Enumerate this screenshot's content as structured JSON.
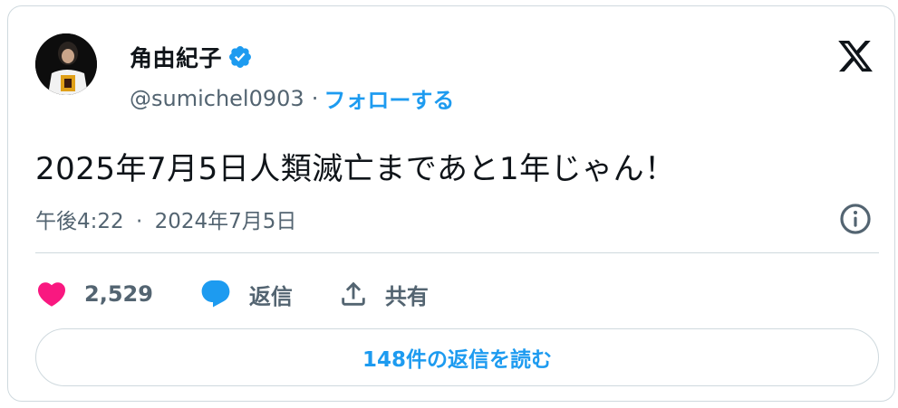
{
  "author": {
    "name": "角由紀子",
    "handle": "@sumichel0903",
    "separator": "·",
    "follow_label": "フォローする"
  },
  "tweet": {
    "text": "2025年7月5日人類滅亡まであと1年じゃん！",
    "time": "午後4:22",
    "date": "2024年7月5日",
    "separator": "·"
  },
  "actions": {
    "likes": "2,529",
    "reply_label": "返信",
    "share_label": "共有"
  },
  "read_replies_label": "148件の返信を読む",
  "colors": {
    "accent": "#1d9bf0",
    "like": "#f91880",
    "text": "#0f1419",
    "muted": "#536471",
    "border": "#cfd9de"
  },
  "icons": [
    "verified-badge-icon",
    "x-logo-icon",
    "info-icon",
    "heart-icon",
    "reply-bubble-icon",
    "share-icon"
  ]
}
